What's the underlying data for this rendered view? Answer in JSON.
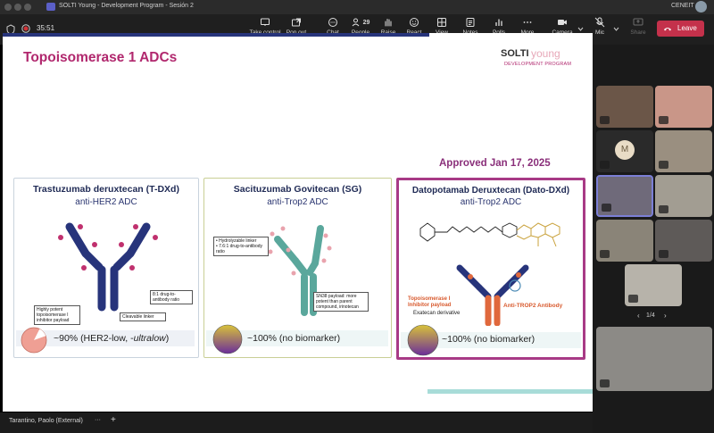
{
  "window": {
    "title": "SOLTI Young - Development Program - Sesión 2",
    "org": "CENEIT"
  },
  "toolbar": {
    "timer": "35:51",
    "buttons": [
      {
        "label": "Take control",
        "icon": "take-control-icon"
      },
      {
        "label": "Pop out",
        "icon": "pop-out-icon"
      },
      {
        "label": "Chat",
        "icon": "chat-icon"
      },
      {
        "label": "People",
        "icon": "people-icon",
        "badge": "29"
      },
      {
        "label": "Raise",
        "icon": "raise-hand-icon"
      },
      {
        "label": "React",
        "icon": "react-icon"
      },
      {
        "label": "View",
        "icon": "view-icon"
      },
      {
        "label": "Notes",
        "icon": "notes-icon"
      },
      {
        "label": "Polls",
        "icon": "polls-icon"
      },
      {
        "label": "More",
        "icon": "more-icon"
      }
    ],
    "camera_label": "Camera",
    "mic_label": "Mic",
    "share_label": "Share",
    "leave_label": "Leave",
    "colors": {
      "leave": "#c4314b",
      "accent": "#6264a7"
    }
  },
  "slide": {
    "title": "Topoisomerase 1 ADCs",
    "logo_main": "SOLTI",
    "logo_accent": "young",
    "logo_sub": "DEVELOPMENT PROGRAM",
    "approved": "Approved Jan 17, 2025",
    "colors": {
      "title": "#b1286e",
      "approved": "#8a2f7a",
      "card3_border": "#a83a86",
      "card2_border": "#c9cf95",
      "card1_border": "#c9d3dd",
      "antibody_blue": "#27347b",
      "antibody_teal": "#5aa79c"
    },
    "cards": [
      {
        "title": "Trastuzumab deruxtecan (T-DXd)",
        "subtitle": "anti-HER2 ADC",
        "notes": [
          "8:1 drug-to-antibody ratio",
          "Highly potent topoisomerase I inhibitor payload",
          "Cleavable linker"
        ],
        "stat_prefix": "~90% (HER2-low, -",
        "stat_italic": "ultralow",
        "stat_suffix": ")",
        "fraction": 0.9
      },
      {
        "title": "Sacituzumab Govitecan (SG)",
        "subtitle": "anti-Trop2 ADC",
        "notes": [
          "Hydrolyzable linker",
          "7.6:1 drug-to-antibody ratio",
          "SN38 payload: more potent than parent compound, irinotecan"
        ],
        "stat": "~100% (no biomarker)",
        "fraction": 1.0
      },
      {
        "title": "Datopotamab Deruxtecan (Dato-DXd)",
        "subtitle": "anti-Trop2 ADC",
        "notes": [
          "Topoisomerase I Inhibitor payload",
          "Exatecan derivative",
          "Anti-TROP2 Antibody"
        ],
        "stat": "~100% (no biomarker)",
        "fraction": 1.0
      }
    ]
  },
  "presenter": {
    "name": "Tarantino, Paolo (External)",
    "more": "···",
    "plus": "+"
  },
  "participants": {
    "page": "1/4",
    "avatar_initial": "M"
  }
}
